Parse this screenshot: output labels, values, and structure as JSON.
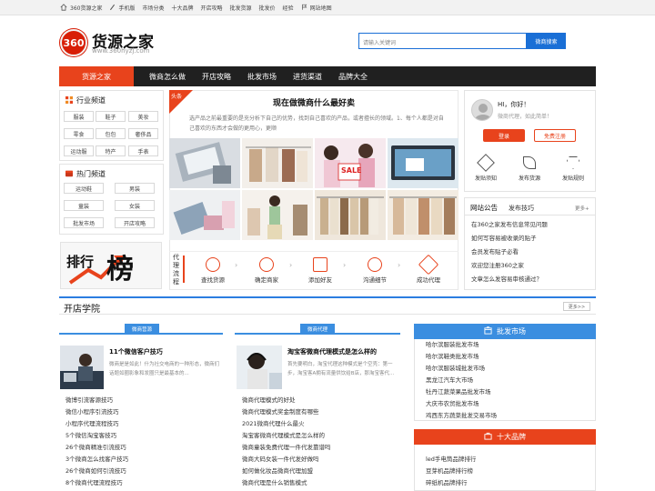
{
  "topbar": {
    "items": [
      {
        "label": "360货源之家",
        "icon": "home-icon"
      },
      {
        "label": "手机版",
        "icon": "mobile-icon"
      },
      {
        "label": "市场分类",
        "icon": ""
      },
      {
        "label": "十大品牌",
        "icon": ""
      },
      {
        "label": "开店攻略",
        "icon": ""
      },
      {
        "label": "批发货源",
        "icon": ""
      },
      {
        "label": "批发价",
        "icon": ""
      },
      {
        "label": "经验",
        "icon": ""
      },
      {
        "label": "网站地图",
        "icon": "flag-icon"
      }
    ]
  },
  "header": {
    "logo_text": "360",
    "brand_name": "货源之家",
    "domain": "www.360hyzj.com",
    "search_placeholder": "请输入关键词",
    "search_button": "微商搜索"
  },
  "nav": {
    "home": "货源之家",
    "items": [
      "微商怎么做",
      "开店攻略",
      "批发市场",
      "进货渠道",
      "品牌大全"
    ]
  },
  "industry": {
    "title": "行业频道",
    "tags": [
      "服装",
      "鞋子",
      "美妆",
      "零食",
      "包包",
      "奢侈品",
      "运动服",
      "特产",
      "手表"
    ]
  },
  "hot": {
    "title": "热门频道",
    "tags": [
      "运动鞋",
      "男装",
      "童装",
      "女装",
      "批发市场",
      "开店攻略"
    ]
  },
  "banner": {
    "text1": "排行",
    "text2": "榜"
  },
  "feature": {
    "ribbon": "头条",
    "title": "现在做微商什么最好卖",
    "desc": "选产品之前最重要的是充分析下自己的优势，找到自己喜欢的产品，或者擅长的领域。1、每个人都是对自己喜欢的东西才会做的更用心，更顺",
    "sale_text": "SALE"
  },
  "process": {
    "label": "代理流程",
    "steps": [
      "查找货源",
      "确定商家",
      "添加好友",
      "沟通细节",
      "成功代理"
    ]
  },
  "user": {
    "greeting": "HI，你好！",
    "sub": "微商代理，如此简单！",
    "login": "登录",
    "register": "免费注册",
    "quick": [
      "发贴须知",
      "发布货源",
      "发贴规则"
    ]
  },
  "notice": {
    "tab1": "网站公告",
    "tab2": "发布技巧",
    "more": "更多+",
    "items": [
      "在360之家发布信息常见问题",
      "如何写容易被收录的贴子",
      "会员发布贴子必看",
      "欢迎您注册360之家",
      "文章怎么发容易审核通过？"
    ]
  },
  "section": {
    "title": "开店学院",
    "more": "更多>>"
  },
  "col1": {
    "pill": "微商营源",
    "lead_title": "11个微信客户技巧",
    "lead_desc": "微商是是如此！什为社交电商的一种形态，微商们话题如圈影象和发圈只是最基本的...",
    "items": [
      "微博引流客源技巧",
      "微信小程序引流技巧",
      "小程序代理流程技巧",
      "5个微信淘宝客技巧",
      "26个微商精准引流技巧",
      "3个微商怎么找客户技巧",
      "26个微商如何引流技巧",
      "8个微商代理流程技巧"
    ]
  },
  "col2": {
    "pill": "微商代理",
    "lead_title": "淘宝客微商代理模式是怎么样的",
    "lead_desc": "首先要明白，淘宝代理这种模式是个空壳：第一步，淘宝客A拥有流量供饮给B店，那淘宝客代...",
    "items": [
      "微商代理模式的好处",
      "微商代理模式奖金制度有哪些",
      "2021微商代理什么最火",
      "淘宝客微商代理模式是怎么样的",
      "微商童装免费代理一件代发靠谱吗",
      "微商大码女装一件代发好做吗",
      "如何做化妆品微商代理加盟",
      "微商代理是什么销售模式"
    ]
  },
  "market": {
    "title": "批发市场",
    "items": [
      "哈尔滨服装批发市场",
      "哈尔滨鞋类批发市场",
      "哈尔滨服装城批发市场",
      "黑龙江汽车大市场",
      "牡丹江蔬菜果品批发市场",
      "大庆市农贸批发市场",
      "鸡西东方蔬菜批发交易市场"
    ]
  },
  "brands": {
    "title": "十大品牌",
    "items": [
      "led手电筒品牌排行",
      "豆芽机品牌排行榜",
      "碎纸机品牌排行"
    ]
  }
}
